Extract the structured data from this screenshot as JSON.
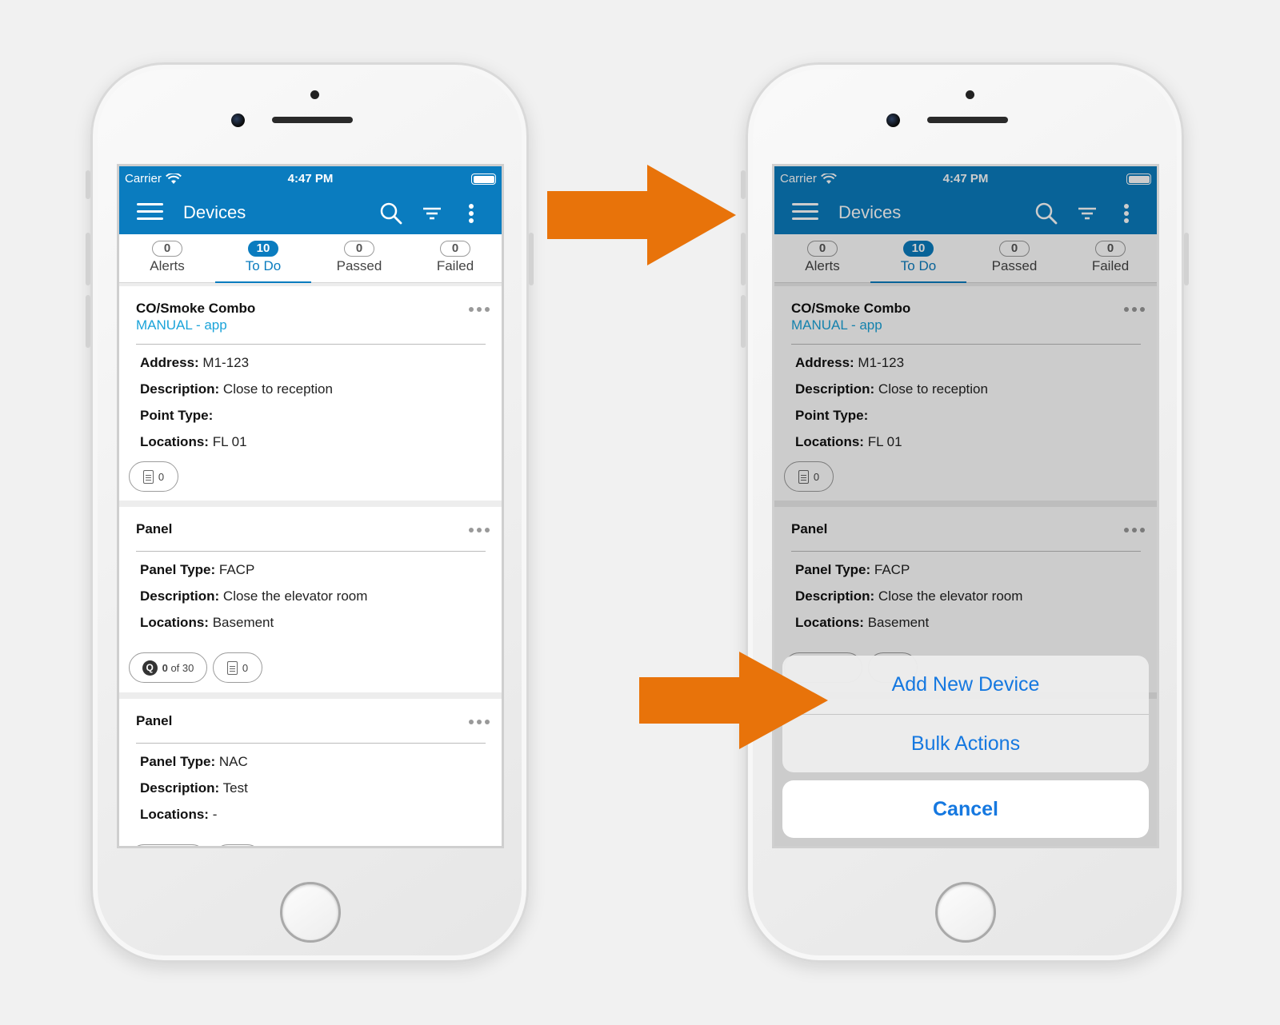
{
  "colors": {
    "primary": "#0a7cbf",
    "link": "#1aa3d9",
    "action": "#1578e0",
    "arrow": "#e8730a"
  },
  "status": {
    "carrier": "Carrier",
    "time": "4:47 PM"
  },
  "appbar": {
    "title": "Devices",
    "icons": [
      "menu-icon",
      "search-icon",
      "filter-icon",
      "more-vertical-icon"
    ]
  },
  "tabs": [
    {
      "count": "0",
      "label": "Alerts"
    },
    {
      "count": "10",
      "label": "To Do"
    },
    {
      "count": "0",
      "label": "Passed"
    },
    {
      "count": "0",
      "label": "Failed"
    }
  ],
  "cards": [
    {
      "title": "CO/Smoke Combo",
      "subtitle": "MANUAL - app",
      "fields": [
        {
          "label": "Address",
          "value": " M1-123"
        },
        {
          "label": "Description",
          "value": " Close to reception"
        },
        {
          "label": "Point Type",
          "value": ""
        },
        {
          "label": "Locations",
          "value": " FL 01"
        }
      ],
      "chips": [
        {
          "text": "0"
        }
      ]
    },
    {
      "title": "Panel",
      "fields": [
        {
          "label": "Panel Type",
          "value": " FACP"
        },
        {
          "label": "Description",
          "value": " Close the elevator room"
        },
        {
          "label": "Locations",
          "value": " Basement"
        }
      ],
      "chips": [
        {
          "q": "Q",
          "bold": "0",
          "text": " of 30"
        },
        {
          "text": "0"
        }
      ]
    },
    {
      "title": "Panel",
      "fields": [
        {
          "label": "Panel Type",
          "value": " NAC"
        },
        {
          "label": "Description",
          "value": " Test"
        },
        {
          "label": "Locations",
          "value": " -"
        }
      ]
    }
  ],
  "action_sheet": {
    "options": [
      "Add New Device",
      "Bulk Actions"
    ],
    "cancel": "Cancel"
  },
  "colon": ":"
}
